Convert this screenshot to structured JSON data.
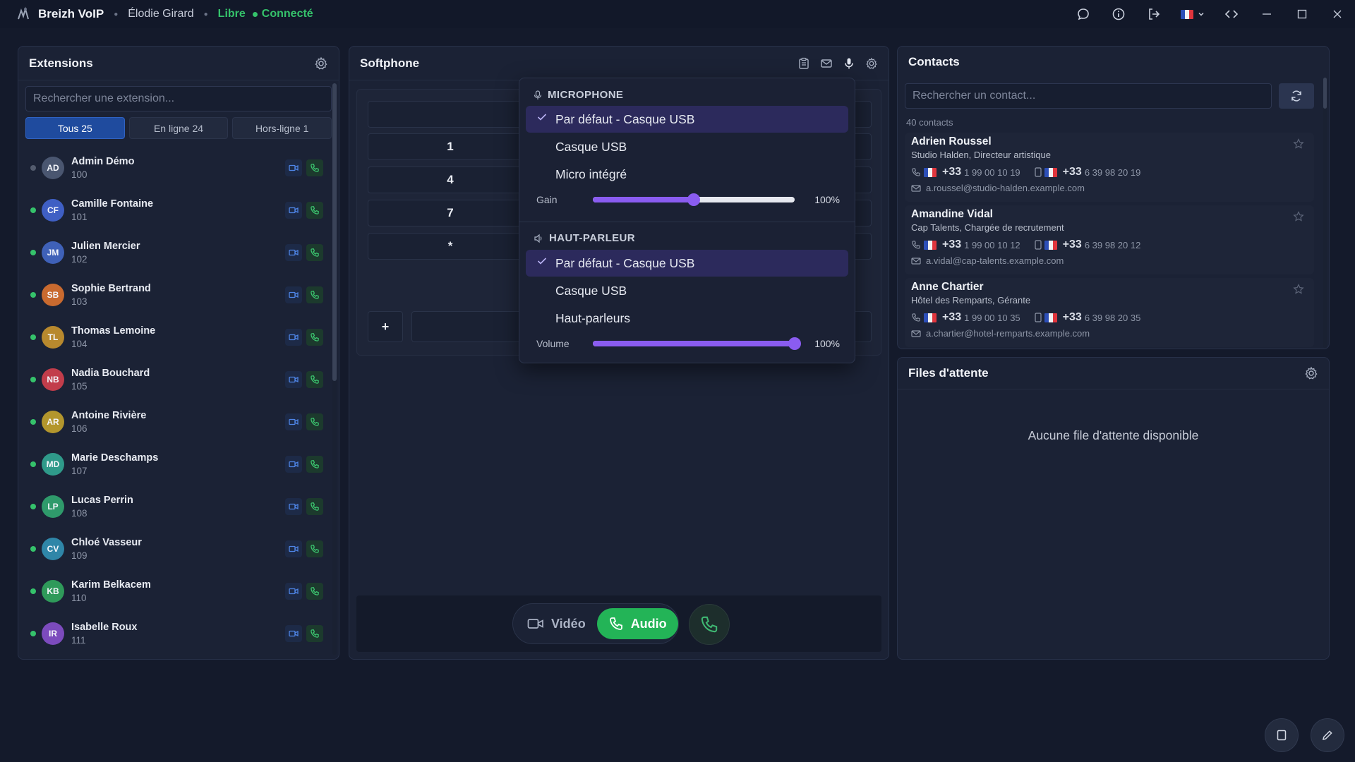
{
  "titlebar": {
    "app_name": "Breizh VoIP",
    "user": "Élodie Girard",
    "status": "Libre",
    "connection": "Connecté"
  },
  "extensions": {
    "title": "Extensions",
    "search_placeholder": "Rechercher une extension...",
    "tabs": [
      {
        "label": "Tous 25",
        "active": true
      },
      {
        "label": "En ligne 24",
        "active": false
      },
      {
        "label": "Hors-ligne 1",
        "active": false
      }
    ],
    "items": [
      {
        "initials": "AD",
        "name": "Admin Démo",
        "ext": "100",
        "online": false,
        "color": "#4a5670"
      },
      {
        "initials": "CF",
        "name": "Camille Fontaine",
        "ext": "101",
        "online": true,
        "color": "#3f5fc4"
      },
      {
        "initials": "JM",
        "name": "Julien Mercier",
        "ext": "102",
        "online": true,
        "color": "#3f61b8"
      },
      {
        "initials": "SB",
        "name": "Sophie Bertrand",
        "ext": "103",
        "online": true,
        "color": "#c96a2f"
      },
      {
        "initials": "TL",
        "name": "Thomas Lemoine",
        "ext": "104",
        "online": true,
        "color": "#b8892e"
      },
      {
        "initials": "NB",
        "name": "Nadia Bouchard",
        "ext": "105",
        "online": true,
        "color": "#c23d4b"
      },
      {
        "initials": "AR",
        "name": "Antoine Rivière",
        "ext": "106",
        "online": true,
        "color": "#b3962d"
      },
      {
        "initials": "MD",
        "name": "Marie Deschamps",
        "ext": "107",
        "online": true,
        "color": "#2f9a8a"
      },
      {
        "initials": "LP",
        "name": "Lucas Perrin",
        "ext": "108",
        "online": true,
        "color": "#2f9a6b"
      },
      {
        "initials": "CV",
        "name": "Chloé Vasseur",
        "ext": "109",
        "online": true,
        "color": "#2f86a8"
      },
      {
        "initials": "KB",
        "name": "Karim Belkacem",
        "ext": "110",
        "online": true,
        "color": "#2f9a5a"
      },
      {
        "initials": "IR",
        "name": "Isabelle Roux",
        "ext": "111",
        "online": true,
        "color": "#7c4bbd"
      }
    ]
  },
  "softphone": {
    "title": "Softphone",
    "keys": {
      "k1": "1",
      "k4": "4",
      "k7": "7",
      "kstar": "*",
      "plus": "+"
    },
    "mode_video": "Vidéo",
    "mode_audio": "Audio"
  },
  "audio_menu": {
    "microphone_header": "MICROPHONE",
    "mic_options": [
      "Par défaut - Casque USB",
      "Casque USB",
      "Micro intégré"
    ],
    "mic_selected": "Par défaut - Casque USB",
    "gain_label": "Gain",
    "gain_value": "100%",
    "gain_level": 0.5,
    "speaker_header": "HAUT-PARLEUR",
    "speaker_options": [
      "Par défaut - Casque USB",
      "Casque USB",
      "Haut-parleurs"
    ],
    "speaker_selected": "Par défaut - Casque USB",
    "volume_label": "Volume",
    "volume_value": "100%",
    "volume_level": 1.0,
    "accent": "#8a5cf0"
  },
  "contacts": {
    "title": "Contacts",
    "search_placeholder": "Rechercher un contact...",
    "count": "40 contacts",
    "items": [
      {
        "name": "Adrien Roussel",
        "sub": "Studio Halden, Directeur artistique",
        "cc1": "+33",
        "phone": "1 99 00 10 19",
        "cc2": "+33",
        "mobile": "6 39 98 20 19",
        "email": "a.roussel@studio-halden.example.com"
      },
      {
        "name": "Amandine Vidal",
        "sub": "Cap Talents, Chargée de recrutement",
        "cc1": "+33",
        "phone": "1 99 00 10 12",
        "cc2": "+33",
        "mobile": "6 39 98 20 12",
        "email": "a.vidal@cap-talents.example.com"
      },
      {
        "name": "Anne Chartier",
        "sub": "Hôtel des Remparts, Gérante",
        "cc1": "+33",
        "phone": "1 99 00 10 35",
        "cc2": "+33",
        "mobile": "6 39 98 20 35",
        "email": "a.chartier@hotel-remparts.example.com"
      }
    ]
  },
  "queues": {
    "title": "Files d'attente",
    "empty_text": "Aucune file d'attente disponible"
  },
  "colors": {
    "online": "#35c26b",
    "primary_tab": "#1f4b9e",
    "audio_button": "#23b457"
  }
}
